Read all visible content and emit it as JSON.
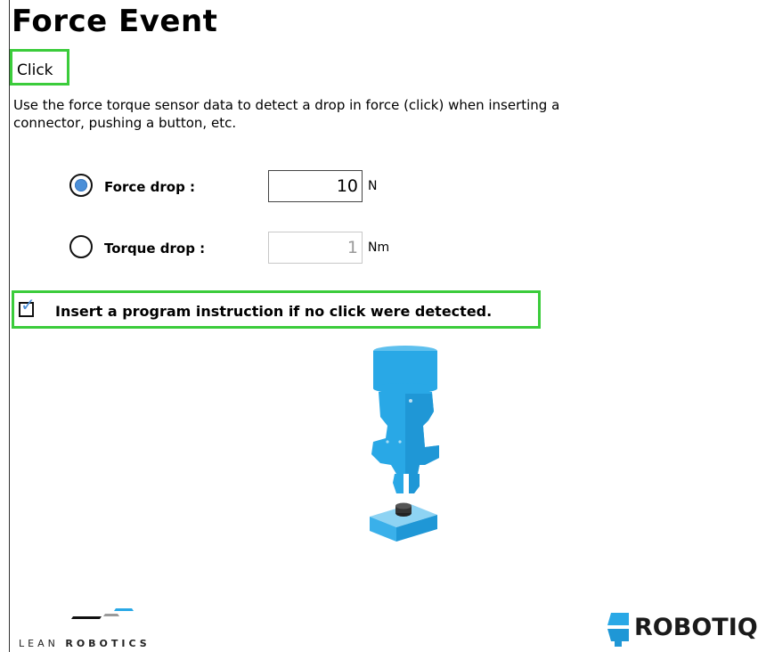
{
  "header": {
    "title": "Force Event",
    "subtitle": "Click",
    "description": "Use the force torque sensor data to detect a drop in force (click) when inserting a connector, pushing a button, etc."
  },
  "options": {
    "force_drop": {
      "label": "Force drop :",
      "value": "10",
      "unit": "N",
      "selected": true
    },
    "torque_drop": {
      "label": "Torque drop :",
      "value": "1",
      "unit": "Nm",
      "selected": false
    }
  },
  "insert_instruction": {
    "label": "Insert a program instruction if no click were detected.",
    "checked": true
  },
  "branding": {
    "left_logo_prefix": "LEAN",
    "left_logo_bold": "ROBOTICS",
    "right_logo": "ROBOTIQ"
  },
  "colors": {
    "accent_blue": "#4b8fd8",
    "highlight_green": "#3bcc3b",
    "gripper_blue": "#29a8e6"
  },
  "icons": [
    "radio-selected-icon",
    "radio-unselected-icon",
    "checkbox-checked-icon",
    "gripper-illustration",
    "lean-robotics-logo",
    "robotiq-logo-icon"
  ]
}
